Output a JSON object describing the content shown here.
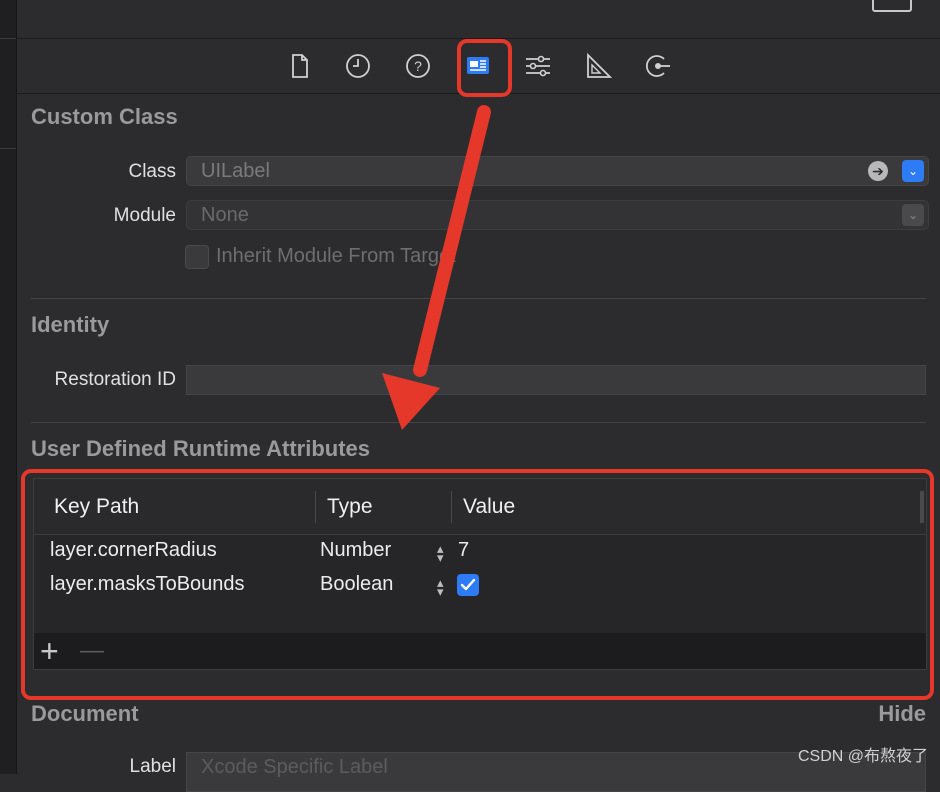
{
  "toolbar": {
    "icons": [
      "file-inspector-icon",
      "history-inspector-icon",
      "quick-help-icon",
      "identity-inspector-icon",
      "attributes-inspector-icon",
      "size-inspector-icon",
      "connections-inspector-icon"
    ]
  },
  "custom_class": {
    "title": "Custom Class",
    "class_label": "Class",
    "class_value": "UILabel",
    "module_label": "Module",
    "module_value": "None",
    "inherit_label": "Inherit Module From Target"
  },
  "identity": {
    "title": "Identity",
    "restoration_label": "Restoration ID",
    "restoration_value": ""
  },
  "runtime": {
    "title": "User Defined Runtime Attributes",
    "columns": [
      "Key Path",
      "Type",
      "Value"
    ],
    "rows": [
      {
        "key": "layer.cornerRadius",
        "type": "Number",
        "value": "7"
      },
      {
        "key": "layer.masksToBounds",
        "type": "Boolean",
        "value": "checked"
      }
    ],
    "add_label": "+",
    "remove_label": "—"
  },
  "document": {
    "title": "Document",
    "hide_label": "Hide",
    "label_label": "Label",
    "label_placeholder": "Xcode Specific Label"
  },
  "colors": {
    "accent": "#2e7bf6",
    "annotation": "#e5372a"
  },
  "watermark": "CSDN @布熬夜了"
}
